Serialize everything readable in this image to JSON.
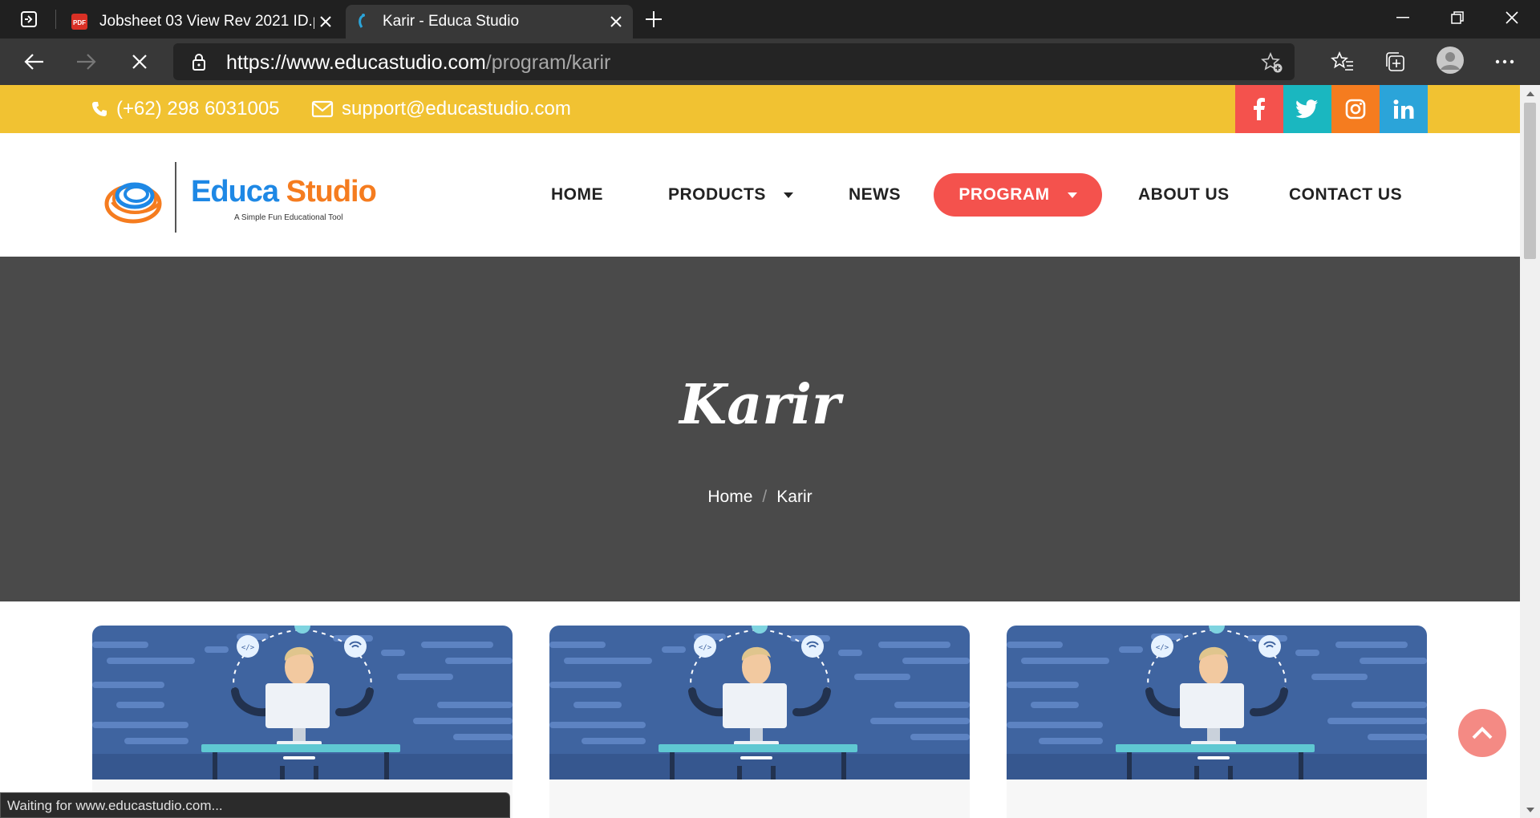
{
  "browser": {
    "tabs": [
      {
        "title": "Jobsheet 03 View Rev 2021 ID.pdf",
        "favicon": "pdf-icon",
        "active": false
      },
      {
        "title": "Karir - Educa Studio",
        "favicon": "educa-favicon",
        "active": true
      }
    ],
    "url": {
      "host": "https://www.educastudio.com",
      "path": "/program/karir"
    },
    "status_text": "Waiting for www.educastudio.com..."
  },
  "topbar": {
    "phone": "(+62) 298 6031005",
    "email": "support@educastudio.com",
    "social": [
      {
        "name": "facebook",
        "glyph": "f",
        "color": "#f4524d"
      },
      {
        "name": "twitter",
        "glyph": "twitter-bird",
        "color": "#1ab7c0"
      },
      {
        "name": "instagram",
        "glyph": "instagram-camera",
        "color": "#f57c1f"
      },
      {
        "name": "linkedin",
        "glyph": "in",
        "color": "#2ba4d9"
      }
    ],
    "bg_color": "#f1c232"
  },
  "logo": {
    "part1": "Educa",
    "part2": "Studio",
    "tagline": "A Simple Fun Educational Tool"
  },
  "nav": {
    "home": "HOME",
    "products": "PRODUCTS",
    "news": "NEWS",
    "program": "PROGRAM",
    "about": "ABOUT US",
    "contact": "CONTACT US",
    "active_color": "#f4524d"
  },
  "hero": {
    "title": "Karir",
    "breadcrumb": {
      "home": "Home",
      "separator": "/",
      "current": "Karir"
    },
    "bg_color": "#4a4a4a"
  },
  "cards": [
    {
      "image": "developer-at-desk-illustration"
    },
    {
      "image": "developer-at-desk-illustration"
    },
    {
      "image": "developer-at-desk-illustration"
    }
  ]
}
